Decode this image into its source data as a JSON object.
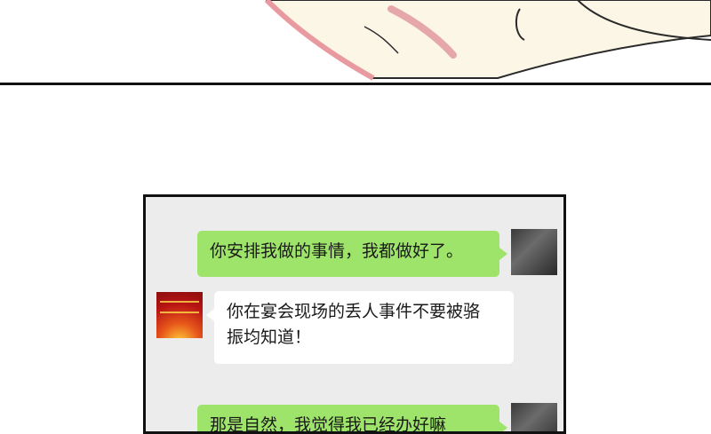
{
  "colors": {
    "bubble_green": "#9ee46a",
    "bubble_white": "#ffffff",
    "chat_background": "#ececec",
    "border": "#111111"
  },
  "messages": [
    {
      "side": "right",
      "text": "你安排我做的事情，我都做好了。"
    },
    {
      "side": "left",
      "line1": "你在宴会现场的丢人事件不要被骆",
      "line2": "振均知道！"
    },
    {
      "side": "right",
      "text": "那是自然，我觉得我已经办好嘛"
    }
  ]
}
